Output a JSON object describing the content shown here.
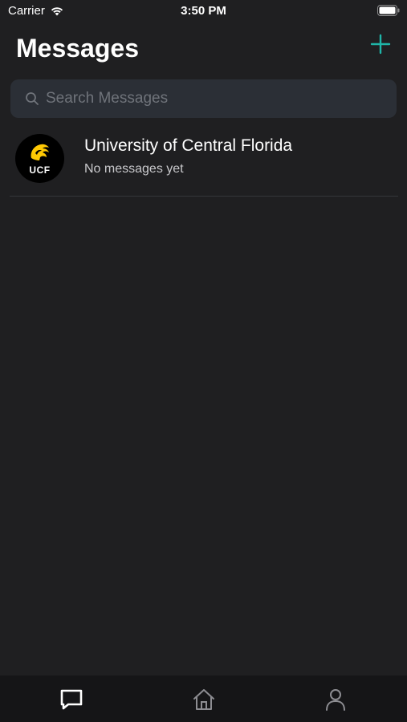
{
  "status_bar": {
    "carrier": "Carrier",
    "time": "3:50 PM",
    "icons": [
      "wifi-icon",
      "battery-icon"
    ]
  },
  "header": {
    "title": "Messages",
    "add_icon": "plus-icon"
  },
  "search": {
    "placeholder": "Search Messages",
    "value": ""
  },
  "conversations": [
    {
      "name": "University of Central Florida",
      "preview": "No messages yet",
      "avatar_text": "UCF"
    }
  ],
  "tab_bar": {
    "tabs": [
      {
        "icon": "message-icon",
        "active": true
      },
      {
        "icon": "home-icon",
        "active": false
      },
      {
        "icon": "profile-icon",
        "active": false
      }
    ]
  },
  "colors": {
    "background": "#1f1f21",
    "accent": "#1fb5a8",
    "search_bg": "#2b2f36",
    "tab_bar_bg": "#151517",
    "ucf_gold": "#ffc904"
  }
}
